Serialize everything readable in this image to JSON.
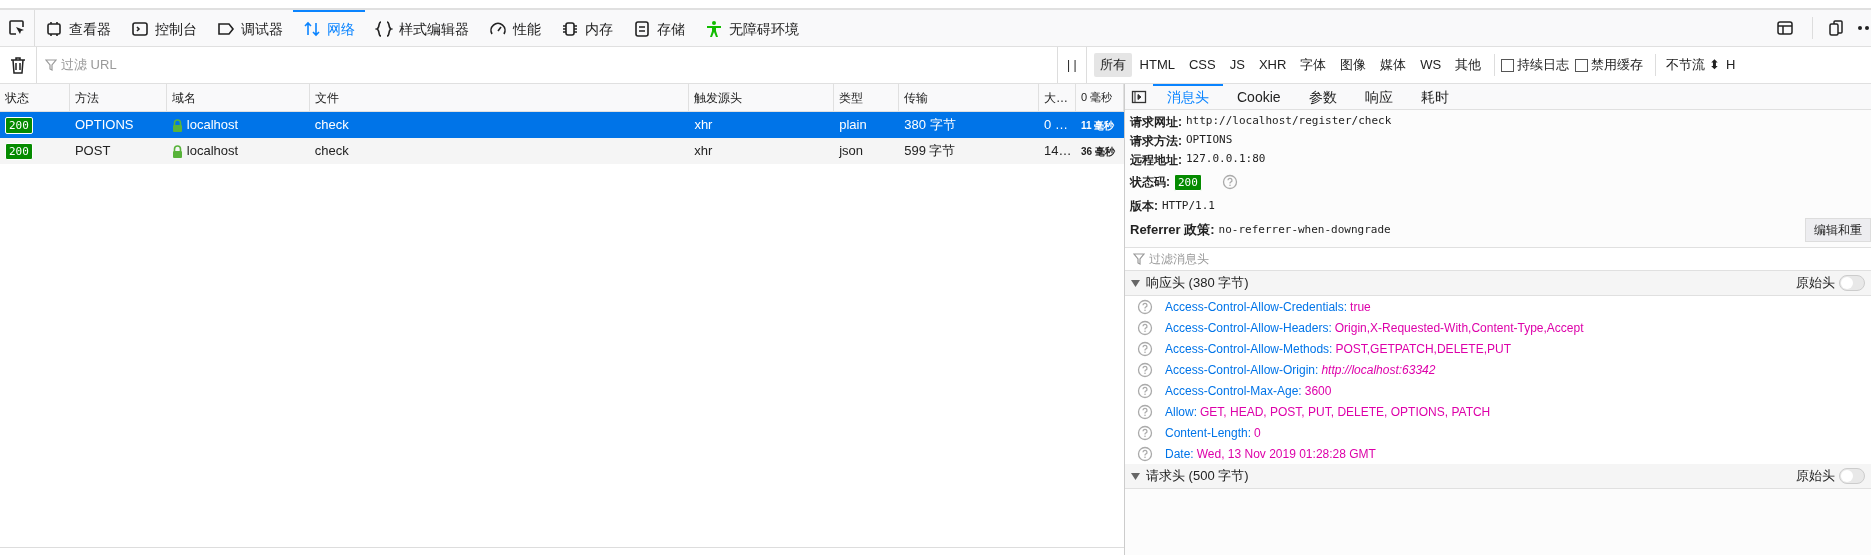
{
  "toolbar": {
    "tools": [
      {
        "label": "查看器",
        "selected": false
      },
      {
        "label": "控制台",
        "selected": false
      },
      {
        "label": "调试器",
        "selected": false
      },
      {
        "label": "网络",
        "selected": true
      },
      {
        "label": "样式编辑器",
        "selected": false
      },
      {
        "label": "性能",
        "selected": false
      },
      {
        "label": "内存",
        "selected": false
      },
      {
        "label": "存储",
        "selected": false
      },
      {
        "label": "无障碍环境",
        "selected": false
      }
    ]
  },
  "filter_bar": {
    "url_filter": {
      "placeholder": "过滤 URL"
    },
    "pause_label": "| |",
    "types": [
      {
        "label": "所有",
        "selected": true
      },
      {
        "label": "HTML",
        "selected": false
      },
      {
        "label": "CSS",
        "selected": false
      },
      {
        "label": "JS",
        "selected": false
      },
      {
        "label": "XHR",
        "selected": false
      },
      {
        "label": "字体",
        "selected": false
      },
      {
        "label": "图像",
        "selected": false
      },
      {
        "label": "媒体",
        "selected": false
      },
      {
        "label": "WS",
        "selected": false
      },
      {
        "label": "其他",
        "selected": false
      }
    ],
    "options": [
      {
        "label": "持续日志",
        "checked": false
      },
      {
        "label": "禁用缓存",
        "checked": false
      }
    ],
    "throttle": "不节流 ⬍",
    "throttle_extra": "H"
  },
  "table": {
    "columns": [
      "状态",
      "方法",
      "域名",
      "文件",
      "触发源头",
      "类型",
      "传输",
      "大…",
      "0 毫秒"
    ],
    "rows": [
      {
        "status": "200",
        "method": "OPTIONS",
        "domain": "localhost",
        "file": "check",
        "cause": "xhr",
        "type": "plain",
        "transferred": "380 字节",
        "size": "0 …",
        "timing": "11 毫秒",
        "selected": true
      },
      {
        "status": "200",
        "method": "POST",
        "domain": "localhost",
        "file": "check",
        "cause": "xhr",
        "type": "json",
        "transferred": "599 字节",
        "size": "14…",
        "timing": "36 毫秒",
        "selected": false
      }
    ]
  },
  "details": {
    "tabs": [
      {
        "label": "消息头",
        "selected": true
      },
      {
        "label": "Cookie",
        "selected": false
      },
      {
        "label": "参数",
        "selected": false
      },
      {
        "label": "响应",
        "selected": false
      },
      {
        "label": "耗时",
        "selected": false
      }
    ],
    "summary": [
      {
        "label": "请求网址:",
        "value": "http://localhost/register/check"
      },
      {
        "label": "请求方法:",
        "value": "OPTIONS"
      },
      {
        "label": "远程地址:",
        "value": "127.0.0.1:80"
      }
    ],
    "status_label": "状态码:",
    "status_code": "200",
    "version_label": "版本:",
    "version": "HTTP/1.1",
    "referrer_label": "Referrer 政策:",
    "referrer": "no-referrer-when-downgrade",
    "edit_resend": "编辑和重",
    "header_filter": {
      "placeholder": "过滤消息头"
    },
    "sections": [
      {
        "title": "响应头 (380 字节)",
        "raw_label": "原始头",
        "raw_on": false,
        "expanded": true,
        "headers": [
          {
            "name": "Access-Control-Allow-Credentials:",
            "value": "true",
            "italic": false
          },
          {
            "name": "Access-Control-Allow-Headers:",
            "value": "Origin,X-Requested-With,Content-Type,Accept",
            "italic": false
          },
          {
            "name": "Access-Control-Allow-Methods:",
            "value": "POST,GETPATCH,DELETE,PUT",
            "italic": false
          },
          {
            "name": "Access-Control-Allow-Origin:",
            "value": "http://localhost:63342",
            "italic": true
          },
          {
            "name": "Access-Control-Max-Age:",
            "value": "3600",
            "italic": false
          },
          {
            "name": "Allow:",
            "value": "GET, HEAD, POST, PUT, DELETE, OPTIONS, PATCH",
            "italic": false
          },
          {
            "name": "Content-Length:",
            "value": "0",
            "italic": false
          },
          {
            "name": "Date:",
            "value": "Wed, 13 Nov 2019 01:28:28 GMT",
            "italic": false
          }
        ]
      },
      {
        "title": "请求头 (500 字节)",
        "raw_label": "原始头",
        "raw_on": false,
        "expanded": true
      }
    ]
  }
}
